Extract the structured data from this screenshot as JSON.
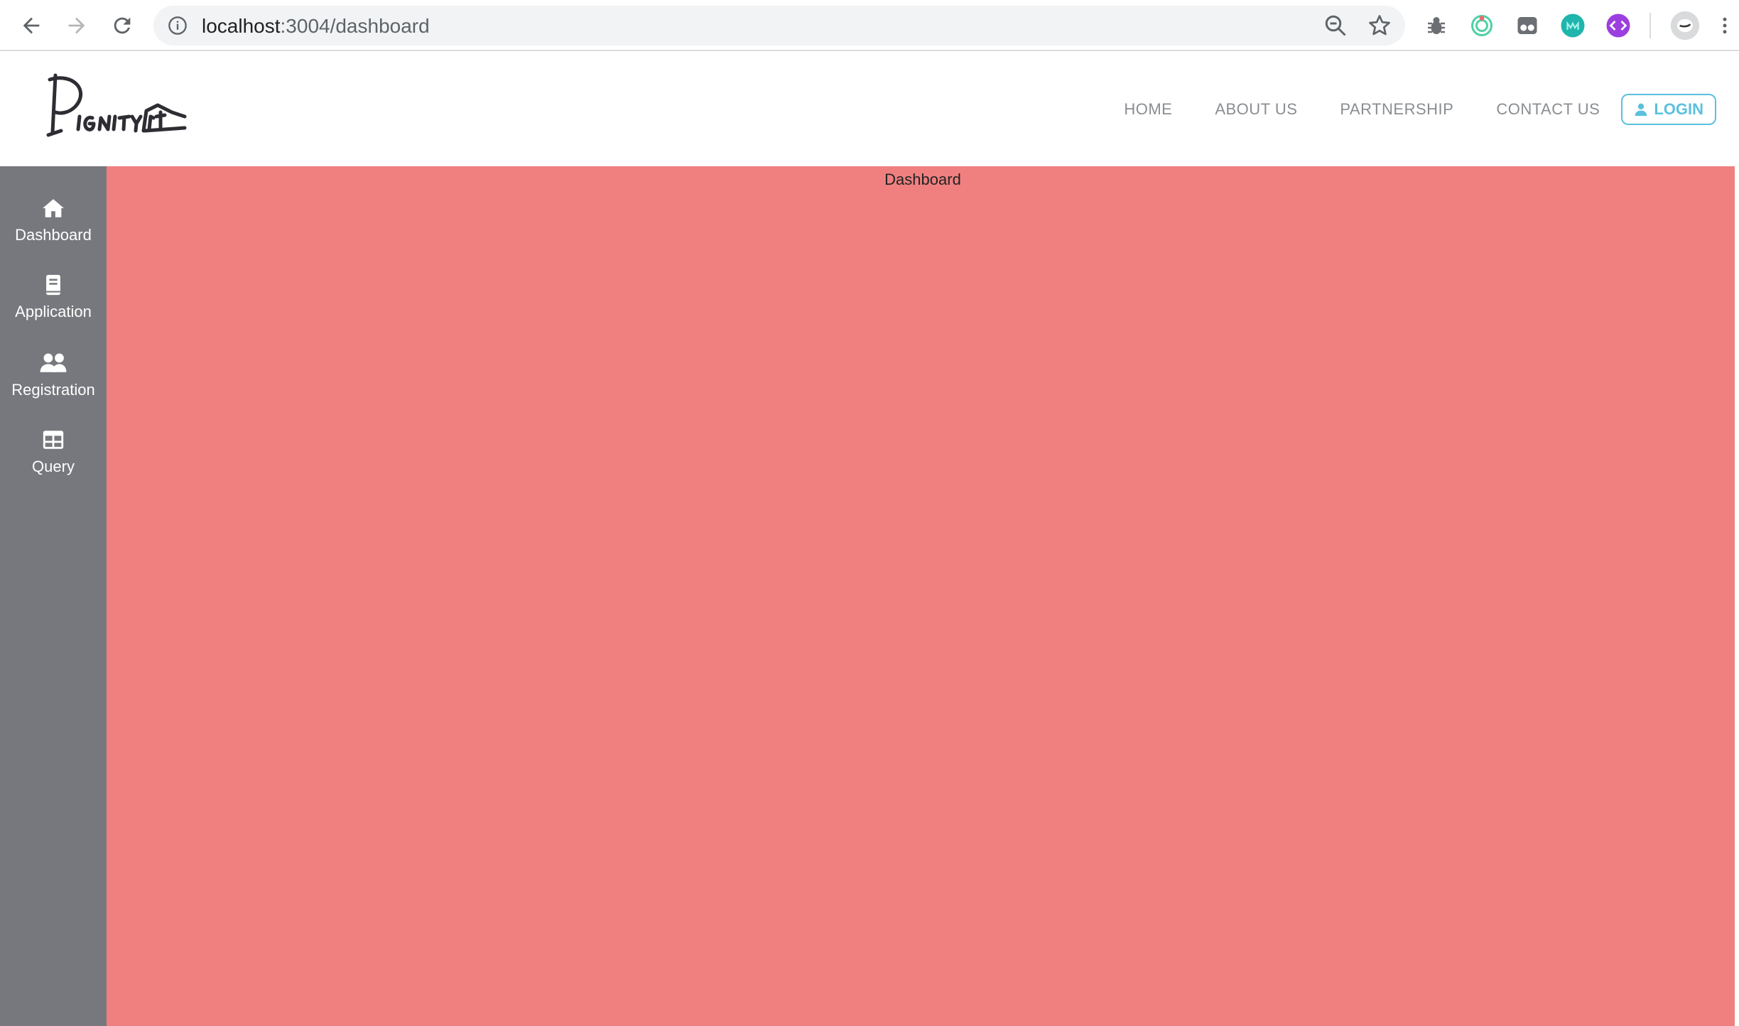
{
  "browser": {
    "url_host": "localhost",
    "url_path": ":3004/dashboard"
  },
  "header": {
    "logo_text": "Dignity",
    "nav": [
      {
        "label": "HOME"
      },
      {
        "label": "ABOUT US"
      },
      {
        "label": "PARTNERSHIP"
      },
      {
        "label": "CONTACT US"
      }
    ],
    "login_label": "LOGIN"
  },
  "sidebar": {
    "items": [
      {
        "label": "Dashboard",
        "icon": "home-icon"
      },
      {
        "label": "Application",
        "icon": "book-icon"
      },
      {
        "label": "Registration",
        "icon": "users-icon"
      },
      {
        "label": "Query",
        "icon": "table-icon"
      }
    ]
  },
  "main": {
    "title": "Dashboard"
  },
  "colors": {
    "sidebar_bg": "#76787d",
    "main_bg": "#f08080",
    "login_accent": "#5bc0de",
    "nav_text": "#8a8d91"
  }
}
